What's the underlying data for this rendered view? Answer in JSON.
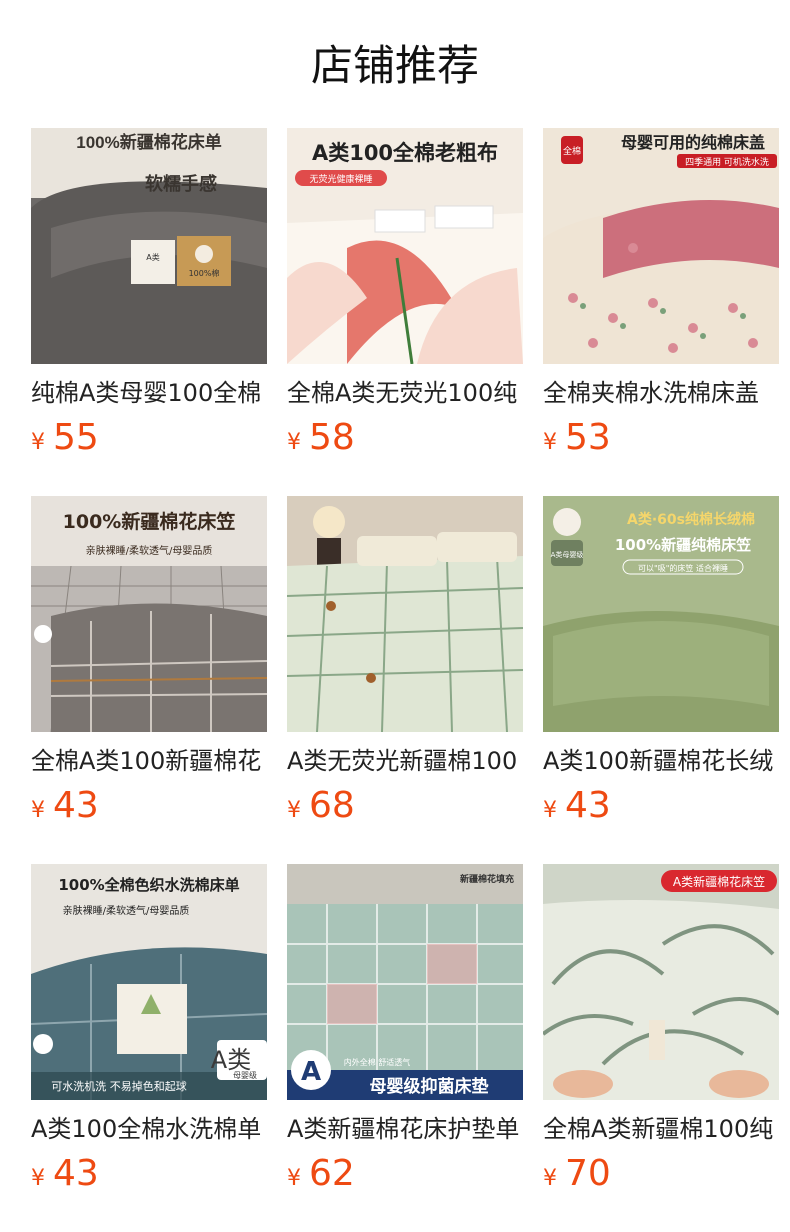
{
  "page": {
    "title": "店铺推荐"
  },
  "currency_symbol": "¥",
  "products": [
    {
      "name": "纯棉A类母婴100全棉",
      "price": "55",
      "img_text": [
        "100%新疆棉花床单",
        "软糯手感"
      ],
      "label_text": [
        "A类",
        "100%棉"
      ],
      "colors": {
        "bg": "#6d6a68",
        "fabric": "#5d5a58",
        "accent": "#c79a55",
        "band": "#e9e4dc",
        "text": "#3a3530"
      }
    },
    {
      "name": "全棉A类无荧光100纯",
      "price": "58",
      "img_text": [
        "A类100全棉老粗布",
        "无荧光健康裸睡"
      ],
      "label_text": [],
      "colors": {
        "bg": "#f3ece3",
        "fabric": "#f7d9ce",
        "accent": "#e5776c",
        "band": "#e04b4b",
        "text": "#222"
      }
    },
    {
      "name": "全棉夹棉水洗棉床盖",
      "price": "53",
      "img_text": [
        "母婴可用的纯棉床盖",
        "四季通用 可机洗水洗",
        "全棉"
      ],
      "label_text": [],
      "colors": {
        "bg": "#efe6d8",
        "fabric": "#efe4d4",
        "accent": "#cc6f7c",
        "band": "#c81e25",
        "text": "#222"
      }
    },
    {
      "name": "全棉A类100新疆棉花",
      "price": "43",
      "img_text": [
        "100%新疆棉花床笠",
        "亲肤裸睡/柔软透气/母婴品质"
      ],
      "label_text": [],
      "colors": {
        "bg": "#bdb8b4",
        "fabric": "#7a7470",
        "accent": "#b07a3e",
        "band": "#e7e2dc",
        "text": "#3a2a1e"
      }
    },
    {
      "name": "A类无荧光新疆棉100",
      "price": "68",
      "img_text": [],
      "label_text": [],
      "colors": {
        "bg": "#d8cdbd",
        "fabric": "#dfe6d4",
        "accent": "#6d8a6a",
        "band": "#f0ead8",
        "text": "#333"
      }
    },
    {
      "name": "A类100新疆棉花长绒",
      "price": "43",
      "img_text": [
        "A类·60s纯棉长绒棉",
        "100%新疆纯棉床笠",
        "可以\"吸\"的床笠 适合裸睡",
        "A类母婴级"
      ],
      "label_text": [],
      "colors": {
        "bg": "#a9b98c",
        "fabric": "#8fa26d",
        "accent": "#f5d66b",
        "band": "#ffffff",
        "text": "#ffffff"
      }
    },
    {
      "name": "A类100全棉水洗棉单",
      "price": "43",
      "img_text": [
        "100%全棉色织水洗棉床单",
        "亲肤裸睡/柔软透气/母婴品质",
        "可水洗机洗 不易掉色和起球",
        "A类",
        "母婴级"
      ],
      "label_text": [],
      "colors": {
        "bg": "#e8e5df",
        "fabric": "#4f6f7a",
        "accent": "#8fb06a",
        "band": "#ffffff",
        "text": "#222"
      }
    },
    {
      "name": "A类新疆棉花床护垫单",
      "price": "62",
      "img_text": [
        "新疆棉花填充",
        "母婴级抑菌床垫",
        "内外全棉 舒适透气"
      ],
      "label_text": [],
      "colors": {
        "bg": "#cfd6cf",
        "fabric": "#a9c4b8",
        "accent": "#e7a8a8",
        "band": "#1f3c74",
        "text": "#ffffff"
      }
    },
    {
      "name": "全棉A类新疆棉100纯",
      "price": "70",
      "img_text": [
        "A类新疆棉花床笠"
      ],
      "label_text": [],
      "colors": {
        "bg": "#cfd5c8",
        "fabric": "#e8ebe1",
        "accent": "#7f9480",
        "band": "#d9282f",
        "text": "#ffffff"
      }
    }
  ]
}
